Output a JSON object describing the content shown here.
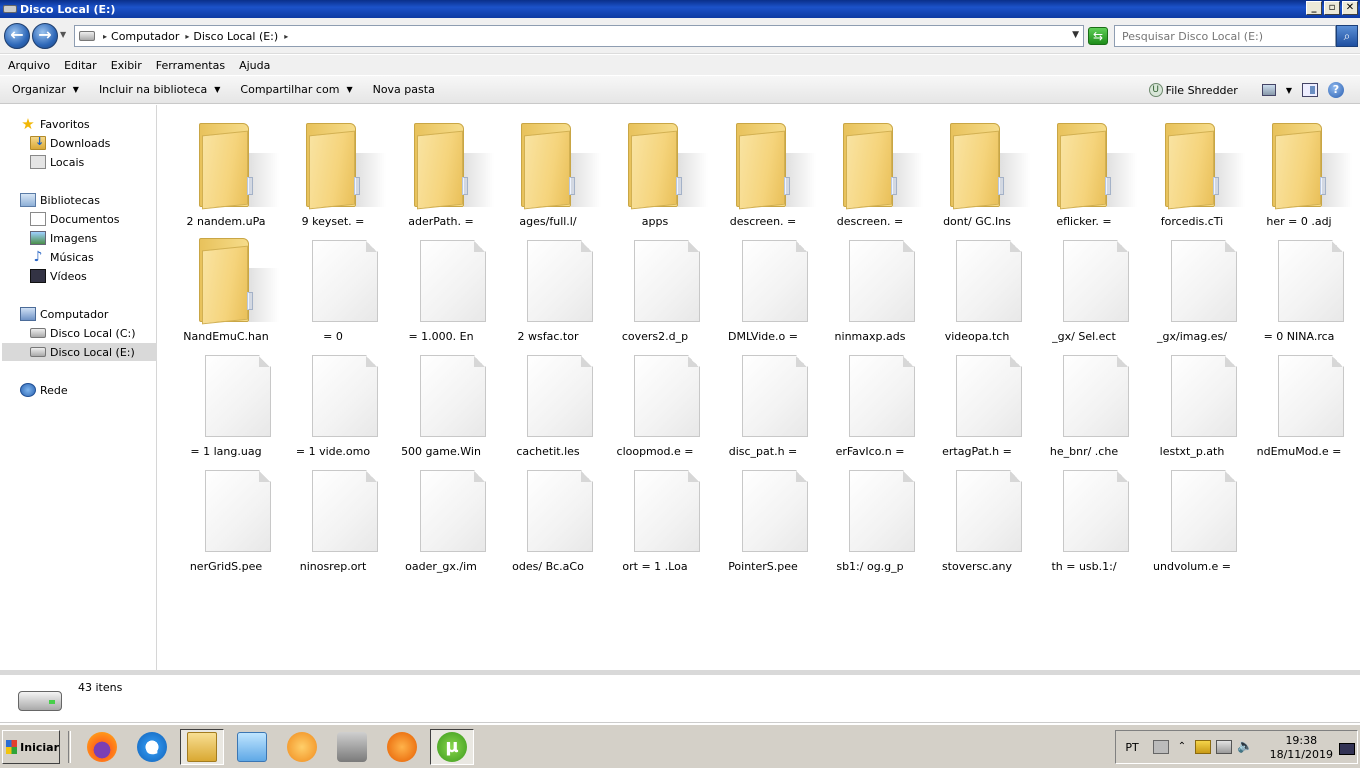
{
  "window": {
    "title": "Disco Local (E:)",
    "min": "_",
    "restore": "▫",
    "close": "✕"
  },
  "address": {
    "crumbs": [
      "Computador",
      "Disco Local (E:)"
    ],
    "search_placeholder": "Pesquisar Disco Local (E:)"
  },
  "menu": [
    "Arquivo",
    "Editar",
    "Exibir",
    "Ferramentas",
    "Ajuda"
  ],
  "commands": {
    "organize": "Organizar",
    "include": "Incluir na biblioteca",
    "share": "Compartilhar com",
    "new_folder": "Nova pasta",
    "file_shredder": "File Shredder"
  },
  "nav": {
    "favorites": "Favoritos",
    "downloads": "Downloads",
    "locais": "Locais",
    "libraries": "Bibliotecas",
    "documents": "Documentos",
    "images": "Imagens",
    "music": "Músicas",
    "videos": "Vídeos",
    "computer": "Computador",
    "drive_c": "Disco Local (C:)",
    "drive_e": "Disco Local (E:)",
    "network": "Rede"
  },
  "items": [
    {
      "name": "2 nandem.uPa",
      "kind": "folder"
    },
    {
      "name": "9 keyset. =",
      "kind": "folder"
    },
    {
      "name": "aderPath. =",
      "kind": "folder"
    },
    {
      "name": "ages/full.l/",
      "kind": "folder"
    },
    {
      "name": "apps",
      "kind": "folder"
    },
    {
      "name": "descreen. =",
      "kind": "folder"
    },
    {
      "name": "descreen. =",
      "kind": "folder"
    },
    {
      "name": "dont/ GC.Ins",
      "kind": "folder"
    },
    {
      "name": "eflicker. =",
      "kind": "folder"
    },
    {
      "name": "forcedis.cTi",
      "kind": "folder"
    },
    {
      "name": "her = 0 .adj",
      "kind": "folder"
    },
    {
      "name": "NandEmuC.han",
      "kind": "folder"
    },
    {
      "name": "= 0",
      "kind": "file"
    },
    {
      "name": "= 1.000. En",
      "kind": "file"
    },
    {
      "name": "2 wsfac.tor",
      "kind": "file"
    },
    {
      "name": "covers2.d_p",
      "kind": "file"
    },
    {
      "name": "DMLVide.o =",
      "kind": "file"
    },
    {
      "name": "ninmaxp.ads",
      "kind": "file"
    },
    {
      "name": "videopa.tch",
      "kind": "file"
    },
    {
      "name": "_gx/ Sel.ect",
      "kind": "file"
    },
    {
      "name": "_gx/imag.es/",
      "kind": "file"
    },
    {
      "name": "= 0 NINA.rca",
      "kind": "file"
    },
    {
      "name": "= 1 lang.uag",
      "kind": "file"
    },
    {
      "name": "= 1 vide.omo",
      "kind": "file"
    },
    {
      "name": "500 game.Win",
      "kind": "file"
    },
    {
      "name": "cachetit.les",
      "kind": "file"
    },
    {
      "name": "cloopmod.e =",
      "kind": "file"
    },
    {
      "name": "disc_pat.h =",
      "kind": "file"
    },
    {
      "name": "erFavIco.n =",
      "kind": "file"
    },
    {
      "name": "ertagPat.h =",
      "kind": "file"
    },
    {
      "name": "he_bnr/ .che",
      "kind": "file"
    },
    {
      "name": "lestxt_p.ath",
      "kind": "file"
    },
    {
      "name": "ndEmuMod.e =",
      "kind": "file"
    },
    {
      "name": "nerGridS.pee",
      "kind": "file"
    },
    {
      "name": "ninosrep.ort",
      "kind": "file"
    },
    {
      "name": "oader_gx./im",
      "kind": "file"
    },
    {
      "name": "odes/ Bc.aCo",
      "kind": "file"
    },
    {
      "name": "ort = 1 .Loa",
      "kind": "file"
    },
    {
      "name": "PointerS.pee",
      "kind": "file"
    },
    {
      "name": "sb1:/ og.g_p",
      "kind": "file"
    },
    {
      "name": "stoversc.any",
      "kind": "file"
    },
    {
      "name": "th = usb.1:/",
      "kind": "file"
    },
    {
      "name": "undvolum.e =",
      "kind": "file"
    }
  ],
  "status": {
    "count": "43 itens"
  },
  "taskbar": {
    "start": "Iniciar",
    "ie_glyph": "e",
    "ut_glyph": "µ",
    "lang": "PT",
    "time": "19:38",
    "date": "18/11/2019",
    "chevron": "⌃",
    "volume": "🔈"
  },
  "icons": {
    "back": "back-arrow-icon",
    "forward": "forward-arrow-icon",
    "refresh": "refresh-icon",
    "search": "magnifier-icon",
    "help": "help-icon"
  }
}
